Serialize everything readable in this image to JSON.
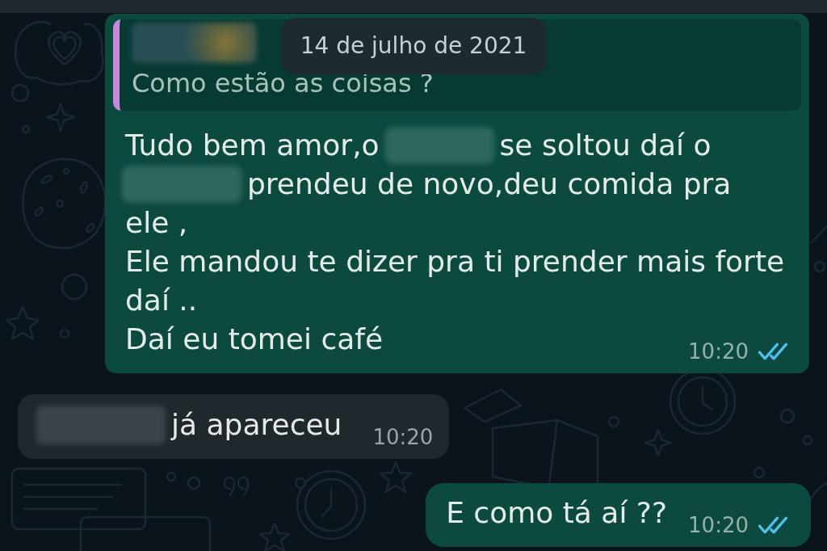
{
  "date_label": "14 de julho de 2021",
  "messages": [
    {
      "kind": "outgoing",
      "quote": {
        "author": {
          "kind": "redacted"
        },
        "text": "Como estão as coisas ?"
      },
      "lines": [
        {
          "segments": [
            {
              "kind": "text",
              "text": "Tudo bem amor,o"
            },
            {
              "kind": "redacted"
            },
            {
              "kind": "text",
              "text": "se soltou daí o"
            }
          ]
        },
        {
          "segments": [
            {
              "kind": "redacted"
            },
            {
              "kind": "text",
              "text": "prendeu de novo,deu comida pra"
            }
          ]
        },
        {
          "segments": [
            {
              "kind": "text",
              "text": "ele ,"
            }
          ]
        },
        {
          "segments": [
            {
              "kind": "text",
              "text": "Ele mandou te dizer pra ti prender mais forte"
            }
          ]
        },
        {
          "segments": [
            {
              "kind": "text",
              "text": "daí .."
            }
          ]
        },
        {
          "segments": [
            {
              "kind": "text",
              "text": "Daí eu tomei café"
            }
          ]
        }
      ],
      "time": "10:20",
      "read": true
    },
    {
      "kind": "incoming",
      "lines": [
        {
          "segments": [
            {
              "kind": "redacted"
            },
            {
              "kind": "text",
              "text": "já apareceu"
            }
          ]
        }
      ],
      "time": "10:20"
    },
    {
      "kind": "outgoing",
      "lines": [
        {
          "segments": [
            {
              "kind": "text",
              "text": "E como tá aí ??"
            }
          ]
        }
      ],
      "time": "10:20",
      "read": true
    }
  ]
}
